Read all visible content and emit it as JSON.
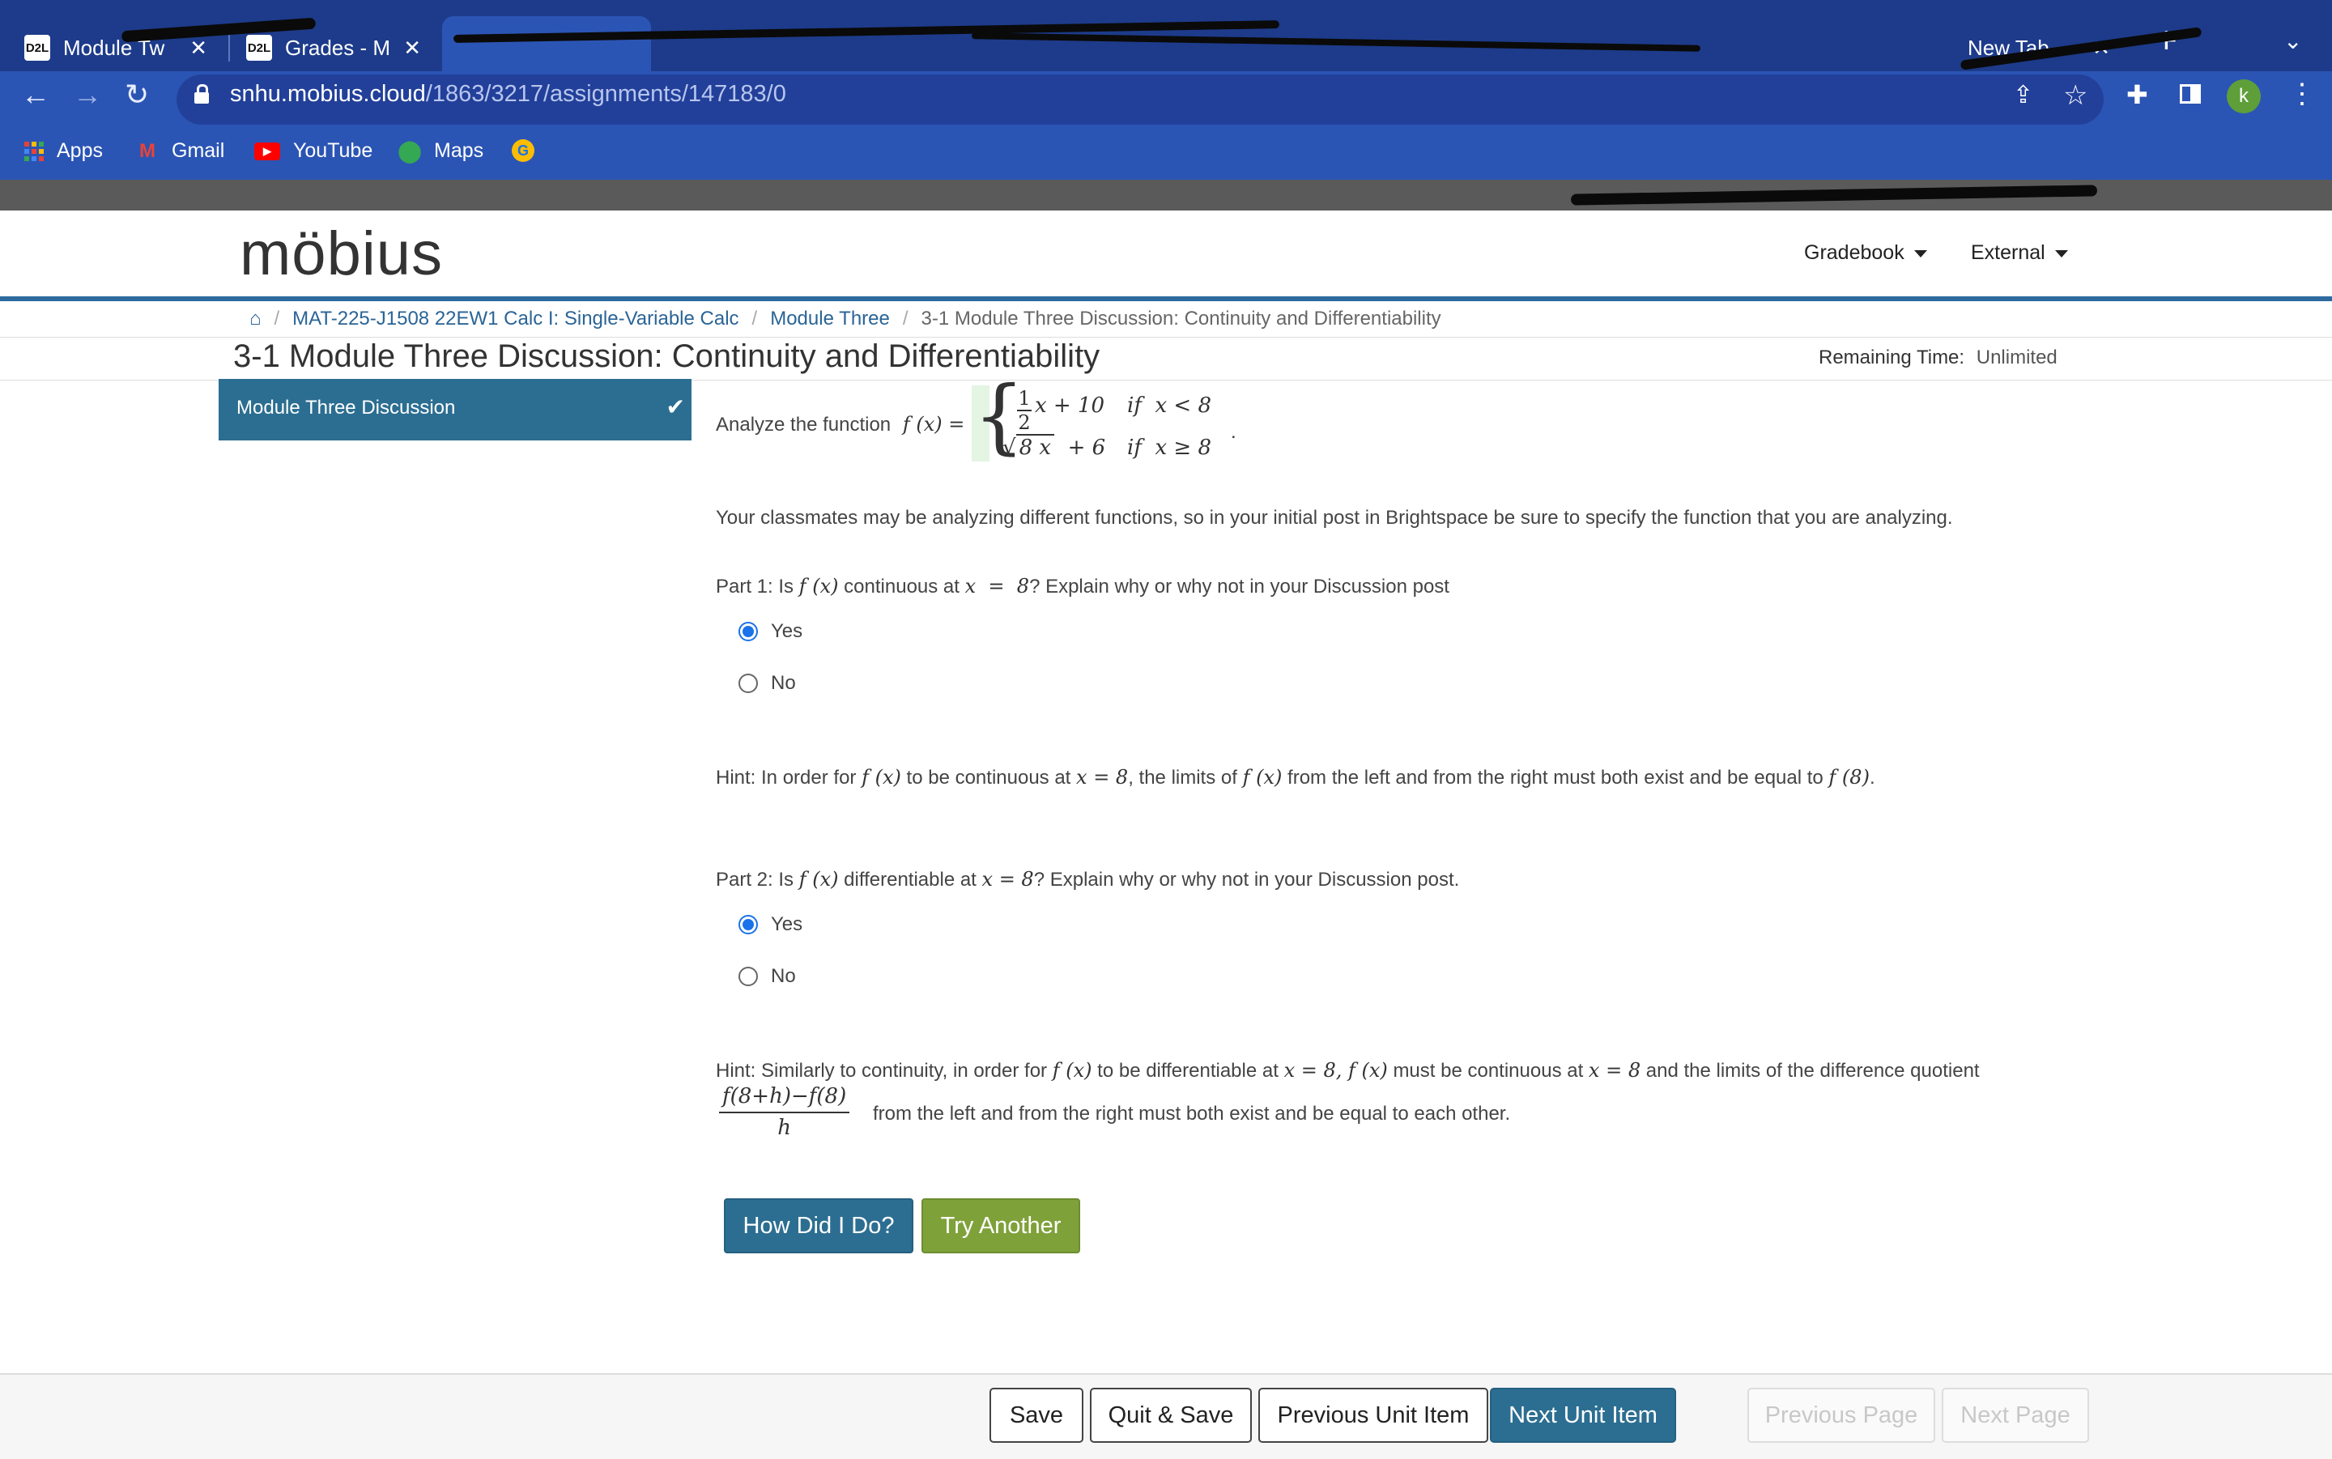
{
  "browser": {
    "tabs": [
      {
        "label": "Module Tw",
        "favicon": "D2L"
      },
      {
        "label": "Grades - M",
        "favicon": "D2L"
      },
      {
        "label": "New Tab",
        "favicon": ""
      }
    ],
    "url_host": "snhu.mobius.cloud",
    "url_path": "/1863/3217/assignments/147183/0",
    "profile_initial": "k",
    "bookmarks": [
      "Apps",
      "Gmail",
      "YouTube",
      "Maps"
    ]
  },
  "site": {
    "logo": "möbius",
    "nav": [
      "Gradebook",
      "External"
    ]
  },
  "breadcrumb": {
    "items": [
      "MAT-225-J1508 22EW1 Calc I: Single-Variable Calc",
      "Module Three"
    ],
    "current": "3-1 Module Three Discussion: Continuity and Differentiability"
  },
  "page": {
    "title": "3-1 Module Three Discussion: Continuity and Differentiability",
    "remaining_label": "Remaining Time:",
    "remaining_value": "Unlimited"
  },
  "sidebar": {
    "item": "Module Three Discussion"
  },
  "content": {
    "analyze_prefix": "Analyze the function",
    "classmates_note": "Your classmates may be analyzing different functions, so in your initial post in Brightspace be sure to specify the function that you are analyzing.",
    "part1": {
      "q_prefix": "Part 1: Is",
      "q_mid": "continuous at",
      "q_suffix": "? Explain why or why not in your Discussion post",
      "options": [
        "Yes",
        "No"
      ],
      "selected": "Yes"
    },
    "hint1": {
      "a": "Hint: In order for",
      "b": "to be continuous at",
      "c": ", the limits of",
      "d": "from the left and from the right must both exist and be equal to",
      "e": "."
    },
    "part2": {
      "q_prefix": "Part 2: Is",
      "q_mid": "differentiable at",
      "q_suffix": "? Explain why or why not in your Discussion post.",
      "options": [
        "Yes",
        "No"
      ],
      "selected": "Yes"
    },
    "hint2": {
      "a": "Hint: Similarly to continuity, in order for",
      "b": "to be differentiable at",
      "c": "must be continuous at",
      "d": "and the limits of the difference quotient",
      "e": "from the left and from the right must both exist and be equal to each other."
    },
    "buttons": {
      "check": "How Did I Do?",
      "another": "Try Another"
    }
  },
  "footer": {
    "save": "Save",
    "quit_save": "Quit & Save",
    "prev_unit": "Previous Unit Item",
    "next_unit": "Next Unit Item",
    "prev_page": "Previous Page",
    "next_page": "Next Page"
  },
  "colors": {
    "chrome_blue": "#2b55b4",
    "sidebar_teal": "#2c6e91",
    "check_button": "#2c6e91",
    "try_button": "#7fa13a",
    "link": "#2a6496"
  }
}
